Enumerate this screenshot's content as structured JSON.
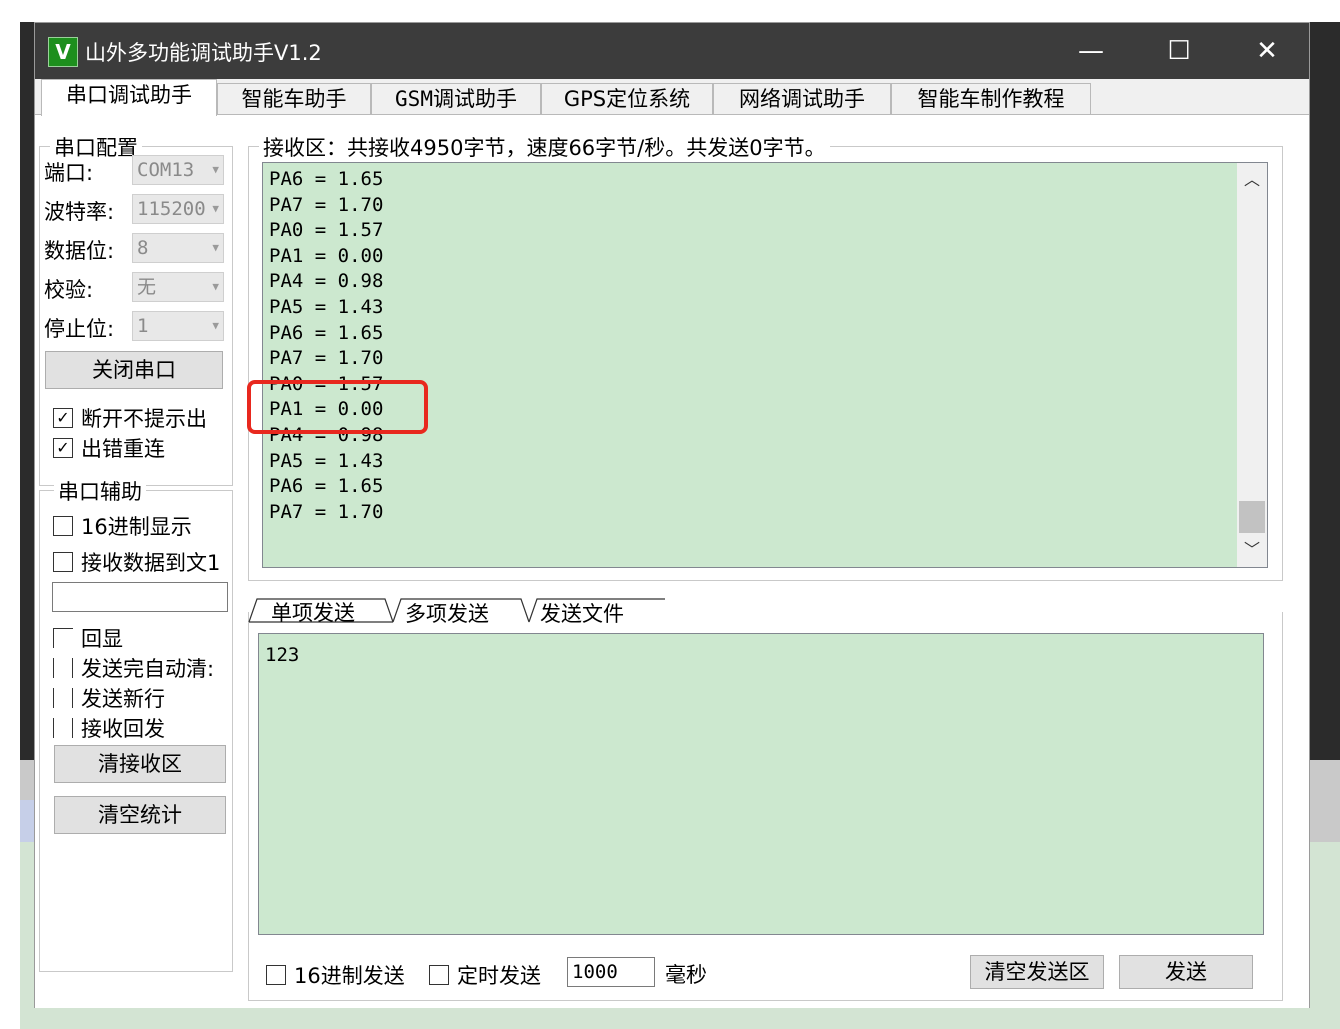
{
  "window": {
    "logo": "V",
    "title": "山外多功能调试助手V1.2",
    "minimize": "—",
    "maximize": "☐",
    "close": "✕"
  },
  "tabs": [
    "串口调试助手",
    "智能车助手",
    "GSM调试助手",
    "GPS定位系统",
    "网络调试助手",
    "智能车制作教程"
  ],
  "serial_config": {
    "title": "串口配置",
    "port_label": "端口:",
    "port_value": "COM13",
    "baud_label": "波特率:",
    "baud_value": "115200",
    "databits_label": "数据位:",
    "databits_value": "8",
    "parity_label": "校验:",
    "parity_value": "无",
    "stopbits_label": "停止位:",
    "stopbits_value": "1",
    "close_port_button": "关闭串口",
    "no_prompt_on_disconnect": "断开不提示出",
    "reconnect_on_error": "出错重连"
  },
  "serial_assist": {
    "title": "串口辅助",
    "hex_display": "16进制显示",
    "recv_to_file": "接收数据到文1",
    "file_path": "",
    "echo": "回显",
    "auto_clear_after_send": "发送完自动清:",
    "send_newline": "发送新行",
    "recv_echo": "接收回发",
    "clear_recv_button": "清接收区",
    "clear_stats_button": "清空统计"
  },
  "receive": {
    "status": "接收区：共接收4950字节，速度66字节/秒。共发送0字节。",
    "lines": [
      "PA6 = 1.65",
      "PA7 = 1.70",
      "PA0 = 1.57",
      "PA1 = 0.00",
      "PA4 = 0.98",
      "PA5 = 1.43",
      "PA6 = 1.65",
      "PA7 = 1.70",
      "PA0 = 1.57",
      "PA1 = 0.00",
      "PA4 = 0.98",
      "PA5 = 1.43",
      "PA6 = 1.65",
      "PA7 = 1.70"
    ],
    "scroll_up": "︿",
    "scroll_down": "﹀"
  },
  "send": {
    "tabs": [
      "单项发送",
      "多项发送",
      "发送文件"
    ],
    "content": "123",
    "hex_send": "16进制发送",
    "timed_send": "定时发送",
    "interval_value": "1000",
    "interval_unit": "毫秒",
    "clear_send_button": "清空发送区",
    "send_button": "发送"
  }
}
